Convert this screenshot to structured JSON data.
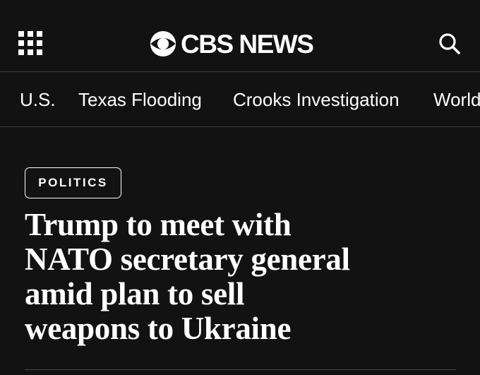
{
  "header": {
    "logo_text": "CBS NEWS",
    "menu_icon": "grid-menu-icon",
    "search_icon": "search-icon"
  },
  "nav": {
    "items": [
      {
        "label": "U.S."
      },
      {
        "label": "Texas Flooding"
      },
      {
        "label": "Crooks Investigation"
      },
      {
        "label": "World"
      }
    ]
  },
  "article": {
    "category": "POLITICS",
    "headline_lines": [
      "Trump to meet with",
      "NATO secretary general",
      "amid plan to sell",
      "weapons to Ukraine"
    ]
  },
  "colors": {
    "background": "#121212",
    "text": "#ffffff",
    "divider": "#3a3a3a"
  }
}
